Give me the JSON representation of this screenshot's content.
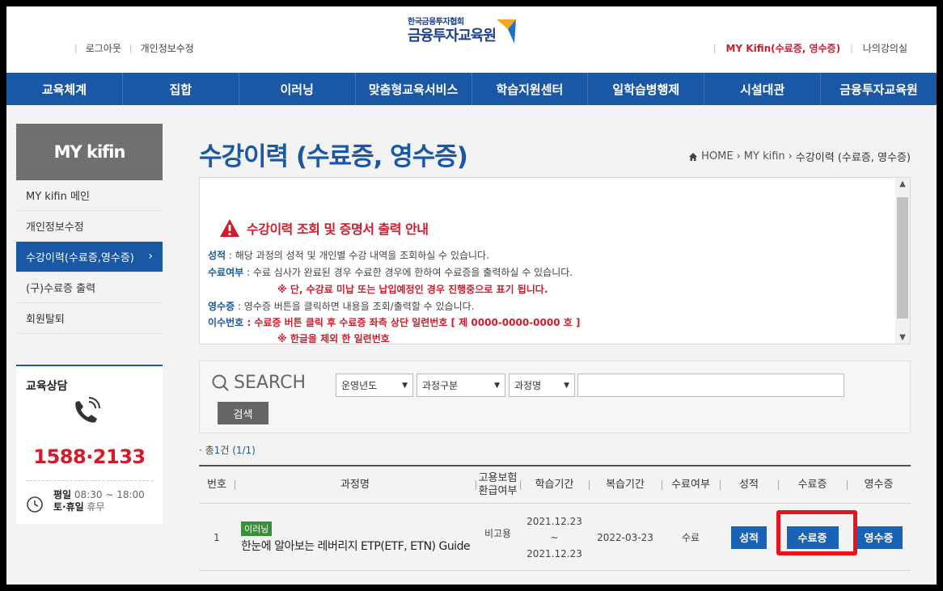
{
  "util_left": [
    "로그아웃",
    "개인정보수정"
  ],
  "logo": {
    "line1": "한국금융투자협회",
    "line2": "금융투자교육원"
  },
  "util_right": [
    "MY Kifin(수료증, 영수증)",
    "나의강의실"
  ],
  "gnb": [
    "교육체계",
    "집합",
    "이러닝",
    "맞춤형교육서비스",
    "학습지원센터",
    "일학습병행제",
    "시설대관",
    "금융투자교육원"
  ],
  "sidebar": {
    "title": "MY kifin",
    "items": [
      {
        "label": "MY kifin 메인"
      },
      {
        "label": "개인정보수정"
      },
      {
        "label": "수강이력(수료증,영수증)",
        "chevron": "›"
      },
      {
        "label": "(구)수료증 출력"
      },
      {
        "label": "회원탈퇴"
      }
    ]
  },
  "counsel": {
    "title": "교육상담",
    "phone": "1588·2133",
    "weekday_label": "평일",
    "weekday_hours": "08:30 ~ 18:00",
    "weekend_label": "토·휴일",
    "weekend_hours": "휴무"
  },
  "page_title": "수강이력 (수료증, 영수증)",
  "breadcrumb": {
    "home": "HOME",
    "sep": "›",
    "level1": "MY kifin",
    "current": "수강이력 (수료증, 영수증)"
  },
  "notice": {
    "title": "수강이력 조회 및 증명서 출력 안내",
    "line1_key": "성적",
    "line1_text": " : 해당 과정의 성적 및 개인별 수강 내역을 조회하실 수 있습니다.",
    "line2_key": "수료여부",
    "line2_text": " : 수료 심사가 완료된 경우 수료한 경우에 한하여 수료증을 출력하실 수 있습니다.",
    "line3": "※ 단, 수강료 미납 또는 납입예정인 경우 진행중으로 표기 됩니다.",
    "line4_key": "영수증",
    "line4_text": " : 영수증 버튼을 클릭하면 내용을 조회/출력할 수 있습니다.",
    "line5_key": "이수번호",
    "line5_text": " : 수료증 버튼 클릭 후 수료증 좌측 상단 일련번호 [ 제 0000-0000-0000 호 ]",
    "line6": "※ 한글을 제외 한 일련번호"
  },
  "search": {
    "label": "SEARCH",
    "selects": [
      "운영년도",
      "과정구분",
      "과정명"
    ],
    "input_value": "",
    "button": "검색"
  },
  "total": {
    "prefix": "· 총",
    "count": "1",
    "unit": "건",
    "pages": "(1/1)"
  },
  "table": {
    "headers": [
      "번호",
      "과정명",
      "고용보험\n환급여부",
      "학습기간",
      "복습기간",
      "수료여부",
      "성적",
      "수료증",
      "영수증"
    ],
    "rows": [
      {
        "no": "1",
        "tag": "이러닝",
        "course": "한눈에 알아보는 레버리지 ETP(ETF, ETN) Guide",
        "refund": "비고용",
        "period_start": "2021.12.23",
        "period_sep": "~",
        "period_end": "2021.12.23",
        "review": "2022-03-23",
        "status": "수료",
        "btn_grade": "성적",
        "btn_cert": "수료증",
        "btn_receipt": "영수증"
      }
    ]
  },
  "colors": {
    "brand_blue": "#1a58a6",
    "accent_red": "#d01c2c",
    "sidebar_gray": "#707070"
  }
}
